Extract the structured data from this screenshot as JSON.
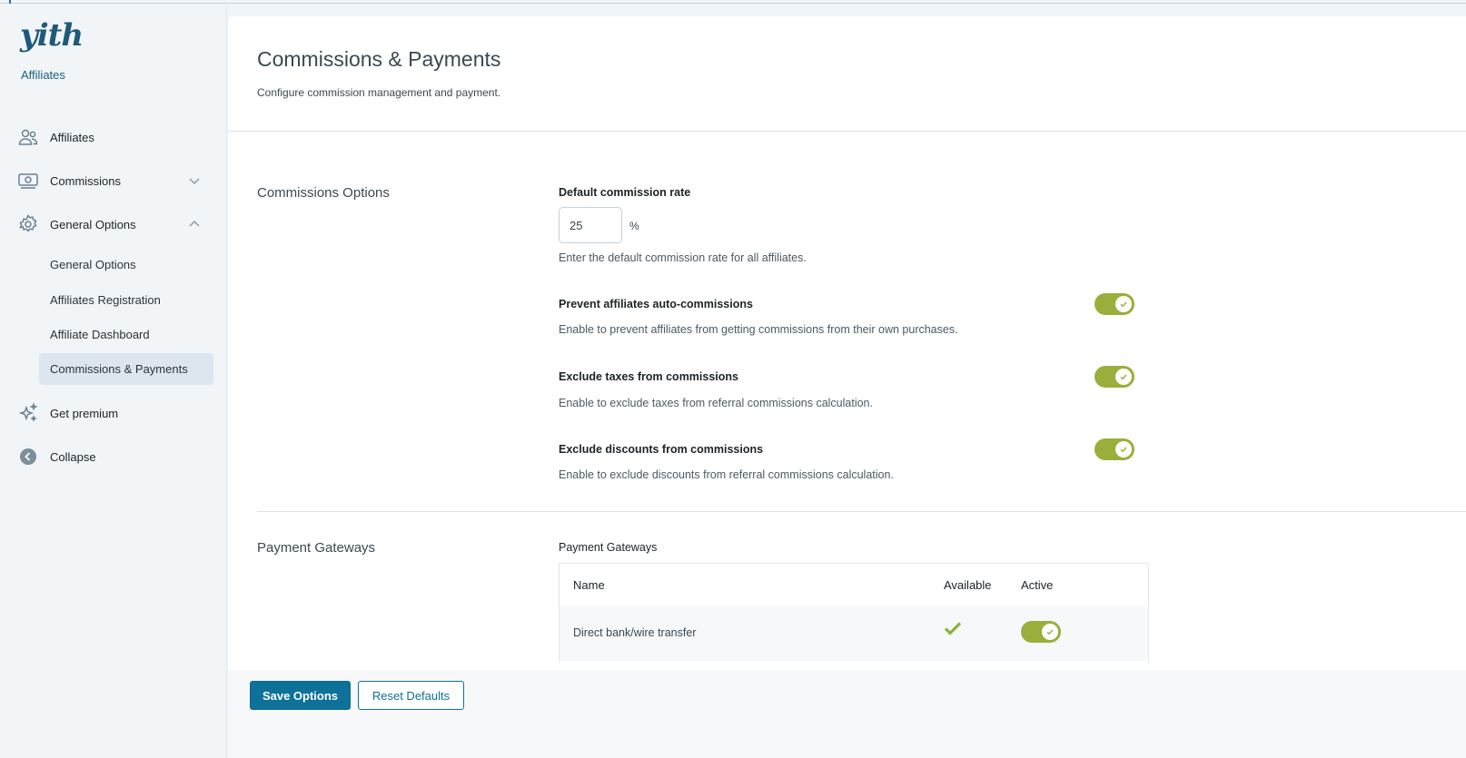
{
  "sidebar": {
    "logo_text": "yith",
    "logo_sub": "Affiliates",
    "nav": {
      "affiliates": "Affiliates",
      "commissions": "Commissions",
      "general_options": "General Options",
      "get_premium": "Get premium",
      "collapse": "Collapse"
    },
    "sub_items": [
      "General Options",
      "Affiliates Registration",
      "Affiliate Dashboard",
      "Commissions & Payments"
    ]
  },
  "header": {
    "title": "Commissions & Payments",
    "description": "Configure commission management and payment."
  },
  "commissions_options": {
    "section_title": "Commissions Options",
    "rate_label": "Default commission rate",
    "rate_value": "25",
    "rate_suffix": "%",
    "rate_desc": "Enter the default commission rate for all affiliates.",
    "prevent_label": "Prevent affiliates auto-commissions",
    "prevent_desc": "Enable to prevent affiliates from getting commissions from their own purchases.",
    "taxes_label": "Exclude taxes from commissions",
    "taxes_desc": "Enable to exclude taxes from referral commissions calculation.",
    "discounts_label": "Exclude discounts from commissions",
    "discounts_desc": "Enable to exclude discounts from referral commissions calculation."
  },
  "payment_gateways": {
    "section_title": "Payment Gateways",
    "field_label": "Payment Gateways",
    "columns": {
      "name": "Name",
      "available": "Available",
      "active": "Active"
    },
    "rows": [
      {
        "name": "Direct bank/wire transfer"
      }
    ]
  },
  "footer": {
    "save_label": "Save Options",
    "reset_label": "Reset Defaults"
  },
  "colors": {
    "accent": "#0e7199",
    "toggle_on": "#9aae3c",
    "check": "#8ab534"
  }
}
